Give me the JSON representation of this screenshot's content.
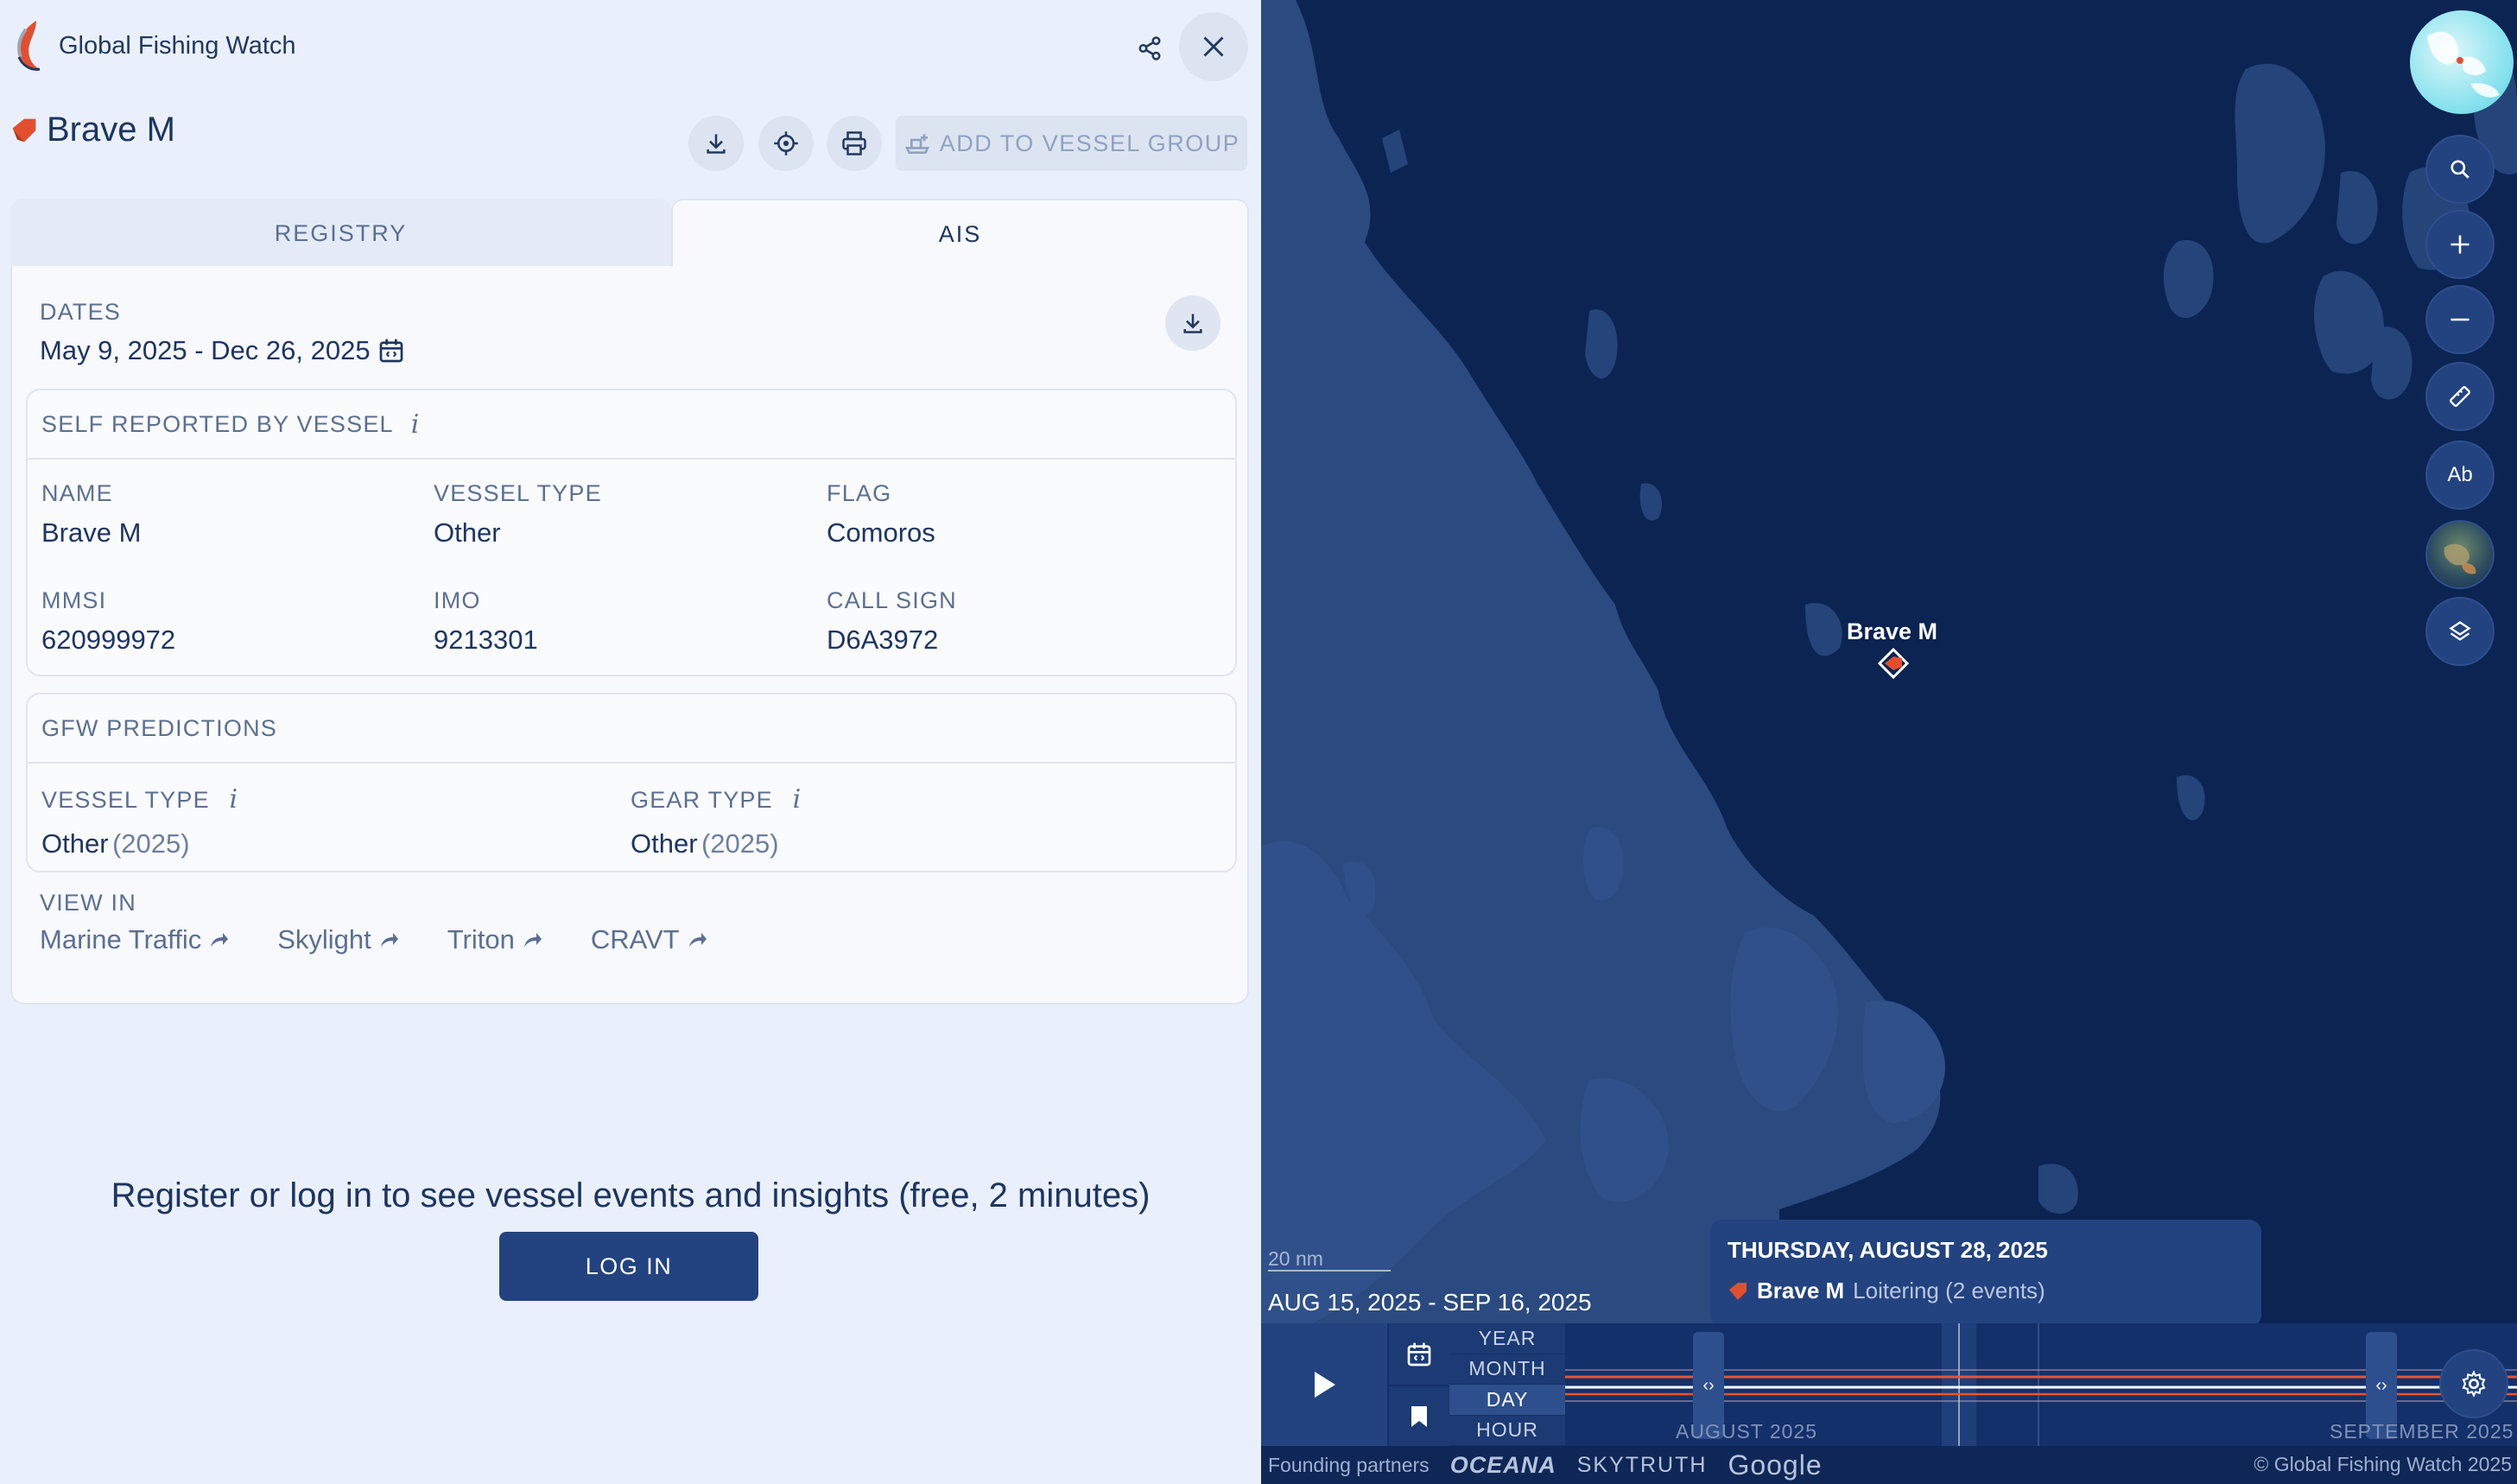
{
  "app": {
    "name": "Global Fishing Watch"
  },
  "vessel": {
    "name": "Brave M",
    "flag_color": "#e24f2f"
  },
  "actions": {
    "add_to_group_label": "ADD TO VESSEL GROUP"
  },
  "tabs": [
    {
      "label": "REGISTRY",
      "active": false
    },
    {
      "label": "AIS",
      "active": true
    }
  ],
  "dates": {
    "label": "DATES",
    "value": "May 9, 2025 - Dec 26, 2025"
  },
  "self_reported": {
    "title": "SELF REPORTED BY VESSEL",
    "info_icon": "i",
    "fields": [
      {
        "label": "NAME",
        "value": "Brave M"
      },
      {
        "label": "VESSEL TYPE",
        "value": "Other"
      },
      {
        "label": "FLAG",
        "value": "Comoros"
      },
      {
        "label": "MMSI",
        "value": "620999972"
      },
      {
        "label": "IMO",
        "value": "9213301"
      },
      {
        "label": "CALL SIGN",
        "value": "D6A3972"
      }
    ]
  },
  "predictions": {
    "title": "GFW PREDICTIONS",
    "fields": [
      {
        "label": "VESSEL TYPE",
        "value": "Other",
        "year": "(2025)"
      },
      {
        "label": "GEAR TYPE",
        "value": "Other",
        "year": "(2025)"
      }
    ]
  },
  "view_in": {
    "label": "VIEW IN",
    "links": [
      "Marine Traffic",
      "Skylight",
      "Triton",
      "CRAVT"
    ]
  },
  "register": {
    "message": "Register or log in to see vessel events and insights (free, 2 minutes)",
    "login_label": "LOG IN"
  },
  "map": {
    "vessel_label": "Brave M",
    "scale": "20 nm",
    "date_range": "AUG 15, 2025 - SEP 16, 2025",
    "controls": [
      {
        "name": "search-icon",
        "label": ""
      },
      {
        "name": "zoom-in-icon",
        "label": ""
      },
      {
        "name": "zoom-out-icon",
        "label": ""
      },
      {
        "name": "ruler-icon",
        "label": ""
      },
      {
        "name": "annotation-icon",
        "label": "Ab"
      },
      {
        "name": "basemap-icon",
        "label": ""
      },
      {
        "name": "layers-icon",
        "label": ""
      }
    ],
    "colors": {
      "sea": "#0b2452",
      "land": "#2a4a80"
    }
  },
  "tooltip": {
    "date": "THURSDAY, AUGUST 28, 2025",
    "vessel": "Brave M",
    "event": "Loitering (2 events)"
  },
  "timebar": {
    "intervals": [
      {
        "label": "YEAR",
        "active": false
      },
      {
        "label": "MONTH",
        "active": false
      },
      {
        "label": "DAY",
        "active": true
      },
      {
        "label": "HOUR",
        "active": false
      }
    ],
    "months": [
      "AUGUST 2025",
      "SEPTEMBER 2025"
    ],
    "handle_glyph": "‹›"
  },
  "footer": {
    "founding_label": "Founding partners",
    "partners": [
      "OCEANA",
      "SKYTRUTH",
      "Google"
    ],
    "copyright": "© Global Fishing Watch 2025"
  }
}
